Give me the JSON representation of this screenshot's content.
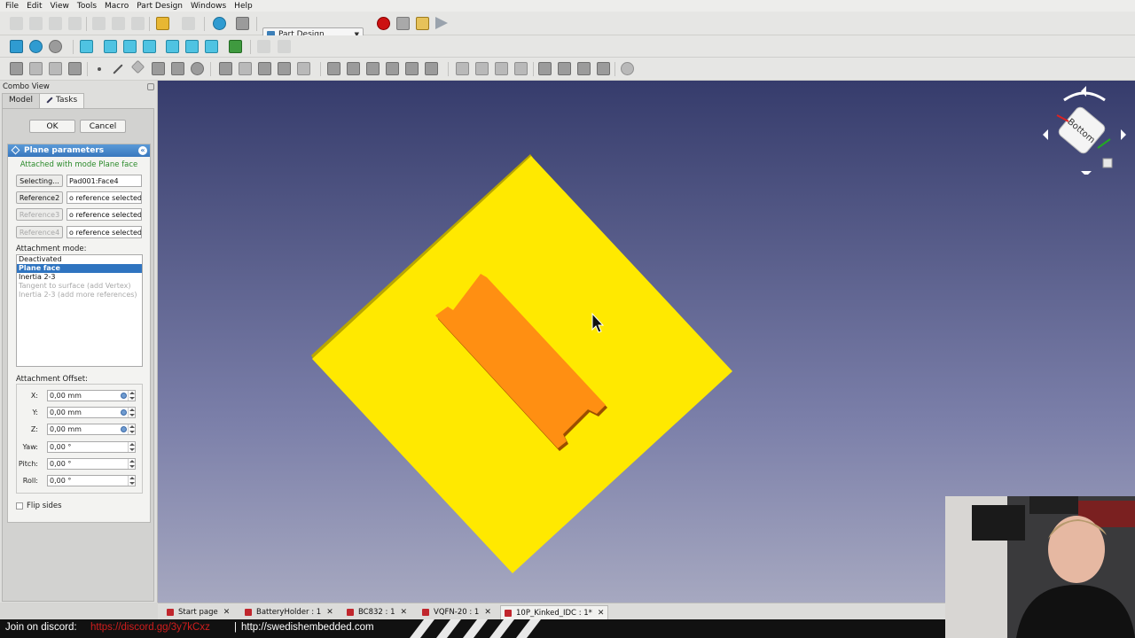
{
  "menu": [
    "File",
    "Edit",
    "View",
    "Tools",
    "Macro",
    "Part Design",
    "Windows",
    "Help"
  ],
  "toolbar": {
    "workbench": "Part Design"
  },
  "combo": {
    "title": "Combo View",
    "tabs": [
      "Model",
      "Tasks"
    ],
    "ok_label": "OK",
    "cancel_label": "Cancel"
  },
  "plane": {
    "header": "Plane parameters",
    "status": "Attached with mode Plane face",
    "refs": [
      {
        "button": "Selecting...",
        "value": "Pad001:Face4"
      },
      {
        "button": "Reference2",
        "value": "o reference selected"
      },
      {
        "button": "Reference3",
        "value": "o reference selected"
      },
      {
        "button": "Reference4",
        "value": "o reference selected"
      }
    ],
    "attachment_mode_label": "Attachment mode:",
    "modes": [
      "Deactivated",
      "Plane face",
      "Inertia 2-3",
      "Tangent to surface (add Vertex)",
      "Inertia 2-3 (add more references)"
    ],
    "offset_label": "Attachment Offset:",
    "offsets": [
      {
        "label": "X:",
        "value": "0,00 mm"
      },
      {
        "label": "Y:",
        "value": "0,00 mm"
      },
      {
        "label": "Z:",
        "value": "0,00 mm"
      },
      {
        "label": "Yaw:",
        "value": "0,00 °"
      },
      {
        "label": "Pitch:",
        "value": "0,00 °"
      },
      {
        "label": "Roll:",
        "value": "0,00 °"
      }
    ],
    "flip_label": "Flip sides"
  },
  "navcube": {
    "face": "Bottom"
  },
  "doc_tabs": [
    "Start page",
    "BatteryHolder : 1",
    "BC832 : 1",
    "VQFN-20 : 1",
    "10P_Kinked_IDC : 1*"
  ],
  "overlay": {
    "prefix": "Join on discord:",
    "link": "https://discord.gg/3y7kCxz",
    "separator": "|",
    "site": "http://swedishembedded.com"
  },
  "colors": {
    "accent": "#2f74c0",
    "plate": "#ffe600",
    "pad": "#ff8c14",
    "overlay_link": "#d21d1d"
  }
}
